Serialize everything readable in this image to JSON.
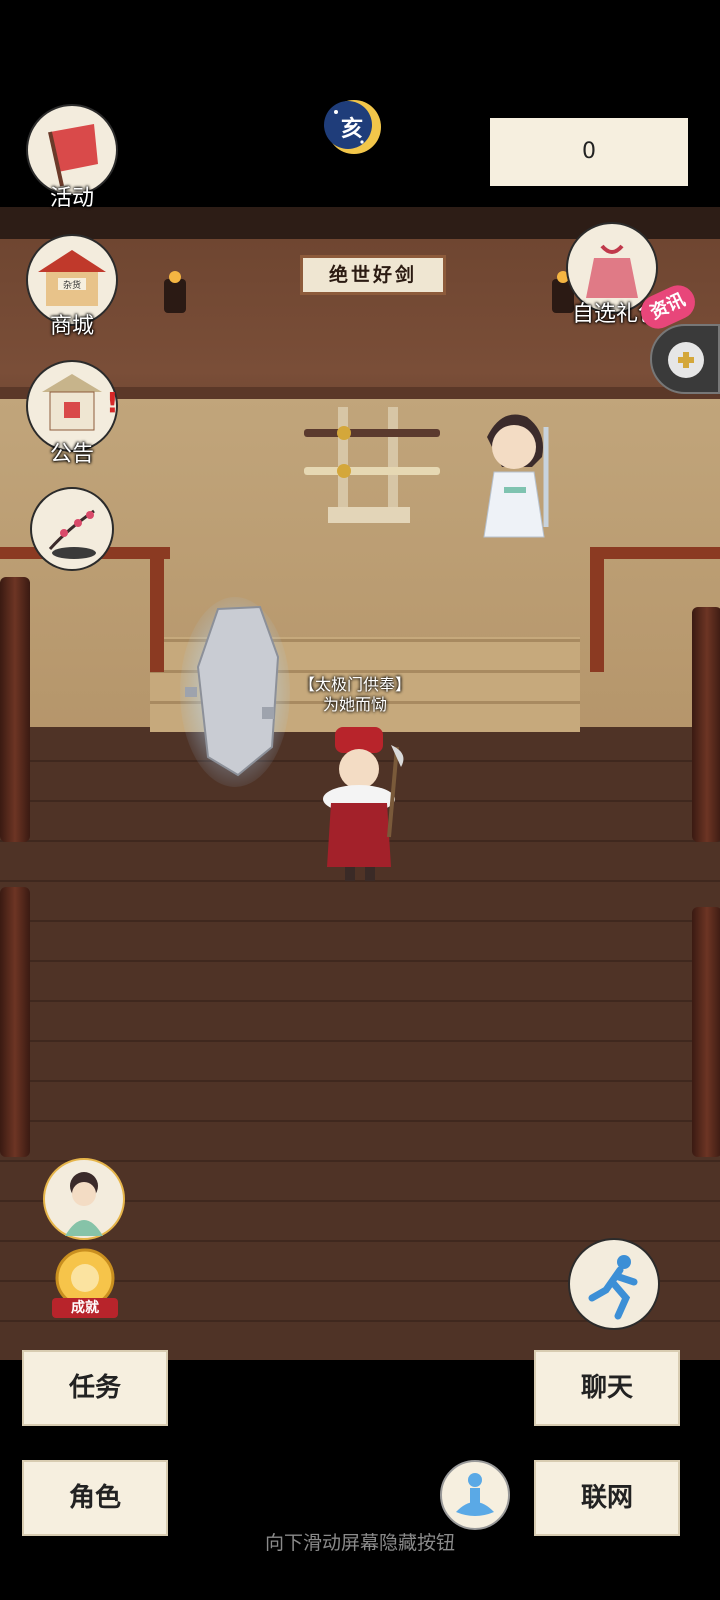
{
  "top_score": "0",
  "moon_badge_text": "亥",
  "menu": {
    "events_label": "活动",
    "shop_label": "商城",
    "notice_label": "公告",
    "gift_label": "自选礼包",
    "news_badge": "资讯"
  },
  "scene": {
    "hall_sign": "绝世好剑",
    "shop_sign": "杂货",
    "npc_title": "【太极门供奉】",
    "npc_name": "为她而恸"
  },
  "achievement_label": "成就",
  "buttons": {
    "tasks": "任务",
    "chat": "聊天",
    "character": "角色",
    "network": "联网"
  },
  "hint_text": "向下滑动屏幕隐藏按钮",
  "colors": {
    "button_bg": "#f6efdf",
    "floor": "#4f3326",
    "wall": "#7a4e38",
    "railing": "#8b3a22"
  }
}
